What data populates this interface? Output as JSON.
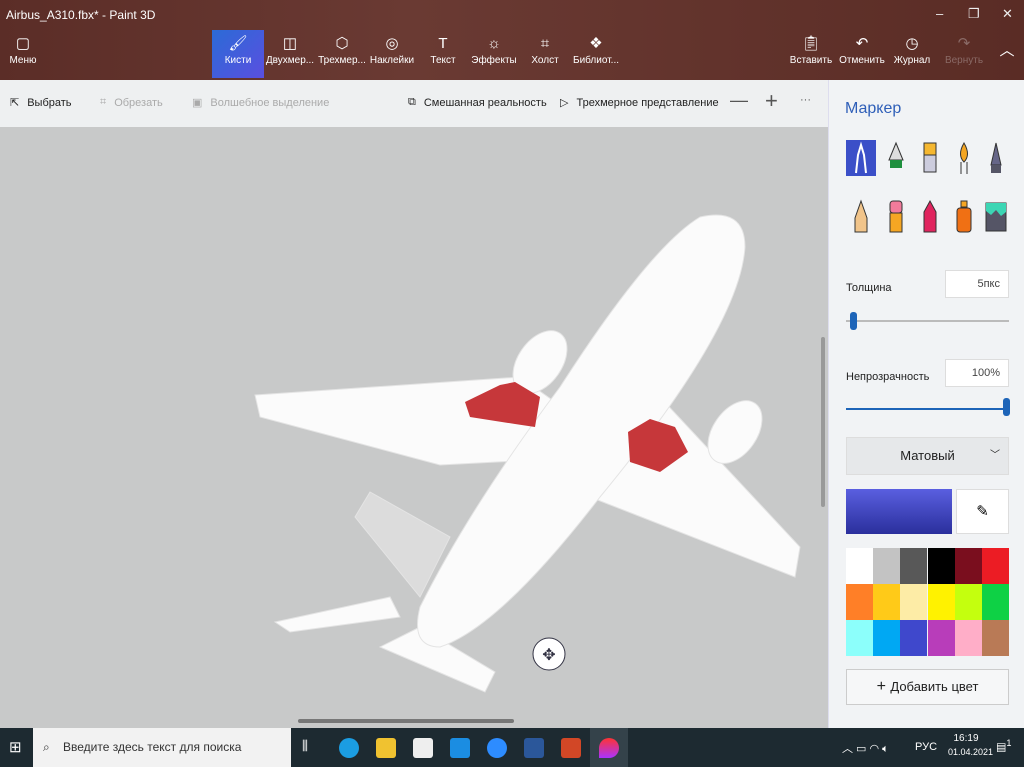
{
  "window": {
    "title": "Airbus_A310.fbx* - Paint 3D",
    "minimize": "–",
    "restore": "❐",
    "close": "✕"
  },
  "ribbon": {
    "menu": "Меню",
    "tools": [
      {
        "label": "Кисти",
        "icon": "brush-icon"
      },
      {
        "label": "Двухмер...",
        "icon": "2d-shapes-icon"
      },
      {
        "label": "Трехмер...",
        "icon": "3d-shapes-icon"
      },
      {
        "label": "Наклейки",
        "icon": "stickers-icon"
      },
      {
        "label": "Текст",
        "icon": "text-icon"
      },
      {
        "label": "Эффекты",
        "icon": "effects-icon"
      },
      {
        "label": "Холст",
        "icon": "canvas-icon"
      },
      {
        "label": "Библиот...",
        "icon": "library-icon"
      }
    ],
    "actions": [
      {
        "label": "Вставить",
        "icon": "paste-icon"
      },
      {
        "label": "Отменить",
        "icon": "undo-icon"
      },
      {
        "label": "Журнал",
        "icon": "history-icon"
      },
      {
        "label": "Вернуть",
        "icon": "redo-icon"
      }
    ]
  },
  "subtoolbar": {
    "select": "Выбрать",
    "crop": "Обрезать",
    "magic_select": "Волшебное выделение",
    "mixed_reality": "Смешанная реальность",
    "view_3d": "Трехмерное представление",
    "zoom_out": "—",
    "zoom_in": "+",
    "more": "···"
  },
  "panel": {
    "title": "Маркер",
    "thickness_label": "Толщина",
    "thickness_value": "5пкс",
    "thickness_fraction": 0.05,
    "opacity_label": "Непрозрачность",
    "opacity_value": "100%",
    "opacity_fraction": 1.0,
    "finish": "Матовый",
    "current_color": "#3a3fc4",
    "add_color": "Добавить цвет",
    "palette": [
      "#ffffff",
      "#c3c3c3",
      "#585858",
      "#000000",
      "#7a0e1e",
      "#ec1c24",
      "#ff7f27",
      "#ffca18",
      "#fdeca6",
      "#fff200",
      "#c4ff0e",
      "#0ed145",
      "#8cfffb",
      "#00a8f3",
      "#3f48cc",
      "#b83dba",
      "#ffaec8",
      "#b97a56"
    ]
  },
  "taskbar": {
    "search_placeholder": "Введите здесь текст для поиска",
    "lang": "РУС",
    "time": "16:19",
    "date": "01.04.2021",
    "notifications": "1"
  }
}
